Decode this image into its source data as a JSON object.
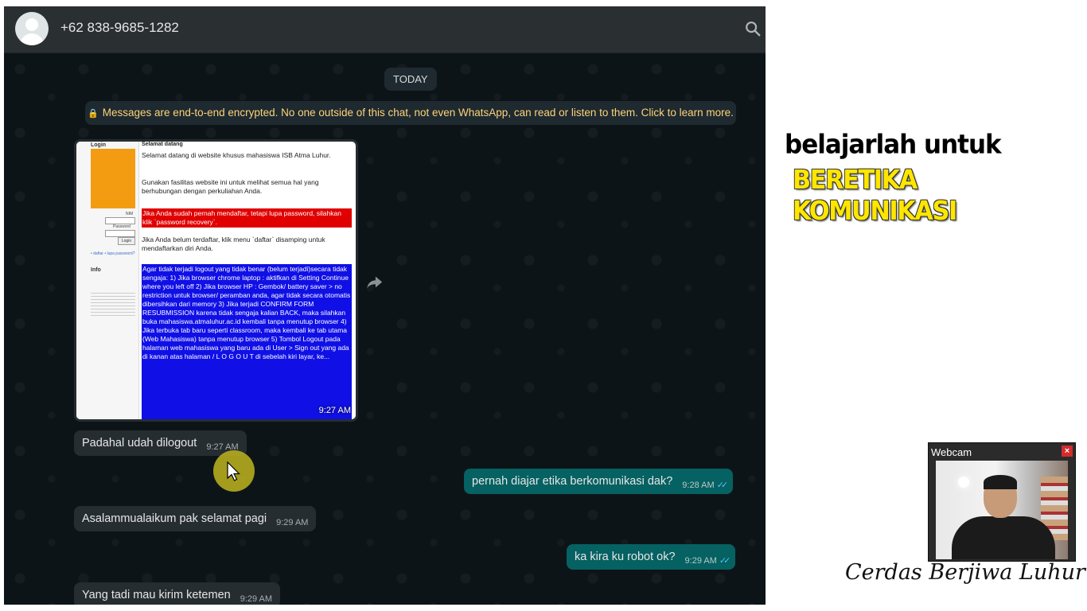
{
  "header": {
    "contact_name": "+62 838-9685-1282"
  },
  "chat": {
    "date_label": "TODAY",
    "encryption_notice": "Messages are end-to-end encrypted. No one outside of this chat, not even WhatsApp, can read or listen to them. Click to learn more.",
    "image_message": {
      "time": "9:27 AM",
      "screenshot": {
        "login_title": "Login",
        "welcome_title": "Selamat datang",
        "nim_label": "NIM",
        "password_label": "Password",
        "login_button": "Login",
        "info_title": "Info",
        "links": "• daftar • lupa password?",
        "p1": "Selamat datang di website khusus mahasiswa ISB Atma Luhur.",
        "p2": "Gunakan fasilitas website ini untuk melihat semua hal yang berhubungan dengan perkuliahan Anda.",
        "p3": "Jika Anda sudah pernah mendaftar, tetapi lupa password, silahkan klik `password recovery`.",
        "p4": "Jika Anda belum terdaftar, klik menu `daftar` disamping untuk mendaftarkan diri Anda.",
        "p5": "Agar tidak terjadi logout yang tidak benar (belum terjadi)secara tidak sengaja: 1) Jika browser chrome laptop : aktifkan di Setting Continue where you left off 2) Jika browser HP : Gembok/ battery saver > no restriction untuk browser/ peramban anda, agar tidak secara otomatis dibersihkan dari memory 3) Jika terjadi CONFIRM FORM RESUBMISSION karena tidak sengaja kalian BACK, maka silahkan buka mahasiswa.atmaluhur.ac.id kembali tanpa menutup browser 4) Jika terbuka tab baru seperti classroom, maka kembali ke tab utama (Web Mahasiswa) tanpa menutup browser 5) Tombol Logout pada halaman web mahasiswa yang baru ada di User > Sign out yang ada di kanan atas halaman / L O G O U T di sebelah kiri layar, ke..."
      }
    },
    "messages": [
      {
        "direction": "in",
        "text": "Padahal udah dilogout",
        "time": "9:27 AM"
      },
      {
        "direction": "out",
        "text": "pernah diajar etika berkomunikasi dak?",
        "time": "9:28 AM",
        "ticks": "✓✓"
      },
      {
        "direction": "in",
        "text": "Asalammualaikum pak selamat pagi",
        "time": "9:29 AM"
      },
      {
        "direction": "out",
        "text": "ka kira ku robot ok?",
        "time": "9:29 AM",
        "ticks": "✓✓"
      },
      {
        "direction": "in",
        "text": "Yang tadi mau kirim ketemen",
        "time": "9:29 AM"
      }
    ]
  },
  "slide": {
    "line1": "belajarlah untuk",
    "line2": "BERETIKA KOMUNIKASI",
    "signature": "Cerdas Berjiwa Luhur"
  },
  "webcam": {
    "title": "Webcam",
    "close": "×"
  },
  "colors": {
    "header_bg": "#2a2f32",
    "chat_bg": "#0d1418",
    "incoming_bubble": "#262d31",
    "outgoing_bubble": "#056162",
    "notice_text": "#ffd279",
    "read_ticks": "#4fc3f7",
    "slogan_yellow": "#ffe600"
  },
  "icons": [
    "avatar-icon",
    "search-icon",
    "lock-icon",
    "forward-icon",
    "double-check-icon",
    "close-icon",
    "cursor-icon"
  ]
}
